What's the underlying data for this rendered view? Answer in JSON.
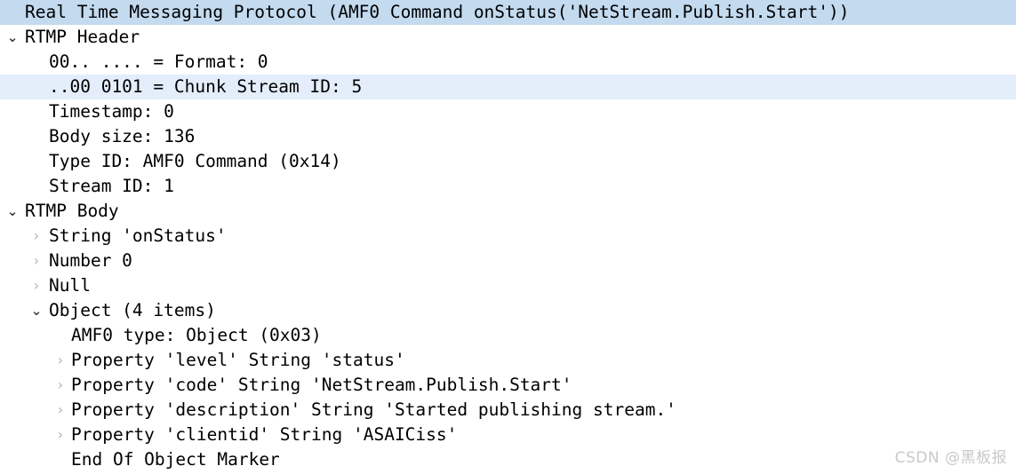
{
  "window": {
    "app": "Wireshark",
    "pane": "packet-details"
  },
  "icons": {
    "expanded": "⌄",
    "collapsed": "›"
  },
  "colors": {
    "background": "#ffffff",
    "text": "#000000",
    "selection_strong": "#c3daef",
    "selection_light": "#e4eefb",
    "chevron_expanded": "#3c3c3c",
    "chevron_collapsed": "#b3b3b3",
    "watermark": "#c9c9c9"
  },
  "tree": {
    "rows": [
      {
        "id": "protocol-root",
        "label": "Real Time Messaging Protocol (AMF0 Command onStatus('NetStream.Publish.Start'))",
        "level": 0,
        "toggle": "none",
        "highlight": "strong"
      },
      {
        "id": "rtmp-header",
        "label": "RTMP Header",
        "level": 0,
        "toggle": "expanded",
        "highlight": "none"
      },
      {
        "id": "format-field",
        "label": "00.. .... = Format: 0",
        "level": 1,
        "toggle": "none",
        "highlight": "none"
      },
      {
        "id": "chunk-stream-id-field",
        "label": "..00 0101 = Chunk Stream ID: 5",
        "level": 1,
        "toggle": "none",
        "highlight": "light"
      },
      {
        "id": "timestamp-field",
        "label": "Timestamp: 0",
        "level": 1,
        "toggle": "none",
        "highlight": "none"
      },
      {
        "id": "body-size-field",
        "label": "Body size: 136",
        "level": 1,
        "toggle": "none",
        "highlight": "none"
      },
      {
        "id": "type-id-field",
        "label": "Type ID: AMF0 Command (0x14)",
        "level": 1,
        "toggle": "none",
        "highlight": "none"
      },
      {
        "id": "stream-id-field",
        "label": "Stream ID: 1",
        "level": 1,
        "toggle": "none",
        "highlight": "none"
      },
      {
        "id": "rtmp-body",
        "label": "RTMP Body",
        "level": 0,
        "toggle": "expanded",
        "highlight": "none"
      },
      {
        "id": "string-onstatus",
        "label": "String 'onStatus'",
        "level": 1,
        "toggle": "collapsed",
        "highlight": "none"
      },
      {
        "id": "number-zero",
        "label": "Number 0",
        "level": 1,
        "toggle": "collapsed",
        "highlight": "none"
      },
      {
        "id": "null-value",
        "label": "Null",
        "level": 1,
        "toggle": "collapsed",
        "highlight": "none"
      },
      {
        "id": "object-node",
        "label": "Object (4 items)",
        "level": 1,
        "toggle": "expanded",
        "highlight": "none"
      },
      {
        "id": "amf0-type-field",
        "label": "AMF0 type: Object (0x03)",
        "level": 2,
        "toggle": "none",
        "highlight": "none"
      },
      {
        "id": "property-level",
        "label": "Property 'level' String 'status'",
        "level": 2,
        "toggle": "collapsed",
        "highlight": "none"
      },
      {
        "id": "property-code",
        "label": "Property 'code' String 'NetStream.Publish.Start'",
        "level": 2,
        "toggle": "collapsed",
        "highlight": "none"
      },
      {
        "id": "property-description",
        "label": "Property 'description' String 'Started publishing stream.'",
        "level": 2,
        "toggle": "collapsed",
        "highlight": "none"
      },
      {
        "id": "property-clientid",
        "label": "Property 'clientid' String 'ASAICiss'",
        "level": 2,
        "toggle": "collapsed",
        "highlight": "none"
      },
      {
        "id": "end-of-object-marker",
        "label": "End Of Object Marker",
        "level": 2,
        "toggle": "none",
        "highlight": "none"
      }
    ]
  },
  "watermark": {
    "text": "CSDN @黑板报"
  }
}
